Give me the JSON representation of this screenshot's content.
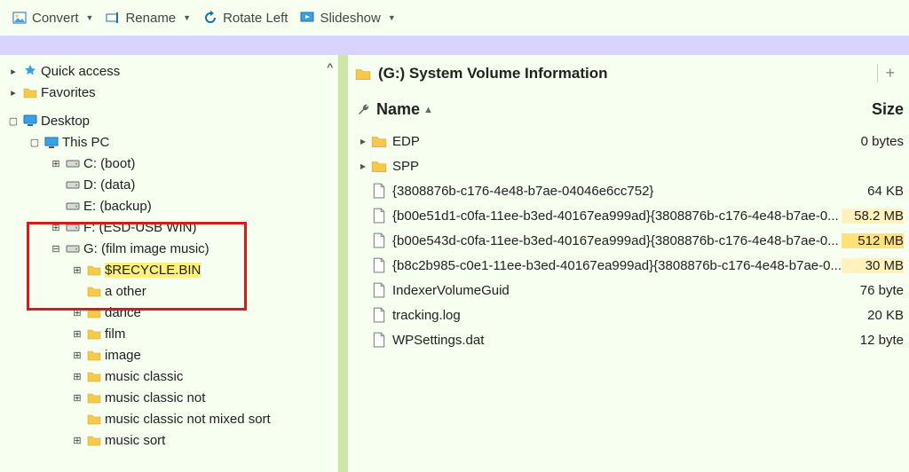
{
  "toolbar": {
    "convert": "Convert",
    "rename": "Rename",
    "rotate_left": "Rotate Left",
    "slideshow": "Slideshow"
  },
  "tree": {
    "quick_access": "Quick access",
    "favorites": "Favorites",
    "desktop": "Desktop",
    "this_pc": "This PC",
    "drive_c": "C: (boot)",
    "drive_d": "D: (data)",
    "drive_e": "E: (backup)",
    "drive_f": "F: (ESD-USB WIN)",
    "drive_g": "G: (film image music)",
    "g_children": [
      "$RECYCLE.BIN",
      "a other",
      "dance",
      "film",
      "image",
      "music classic",
      "music classic not",
      "music classic not mixed sort",
      "music sort"
    ]
  },
  "breadcrumb": {
    "title": "(G:) System Volume Information"
  },
  "columns": {
    "name": "Name",
    "size": "Size"
  },
  "rows": [
    {
      "type": "folder",
      "expandable": true,
      "name": "EDP",
      "size": "0 bytes",
      "hl": ""
    },
    {
      "type": "folder",
      "expandable": true,
      "name": "SPP",
      "size": "",
      "hl": ""
    },
    {
      "type": "file",
      "expandable": false,
      "name": "{3808876b-c176-4e48-b7ae-04046e6cc752}",
      "size": "64 KB",
      "hl": ""
    },
    {
      "type": "file",
      "expandable": false,
      "name": "{b00e51d1-c0fa-11ee-b3ed-40167ea999ad}{3808876b-c176-4e48-b7ae-0...",
      "size": "58.2 MB",
      "hl": "hl-size"
    },
    {
      "type": "file",
      "expandable": false,
      "name": "{b00e543d-c0fa-11ee-b3ed-40167ea999ad}{3808876b-c176-4e48-b7ae-0...",
      "size": "512 MB",
      "hl": "hl-size-strong"
    },
    {
      "type": "file",
      "expandable": false,
      "name": "{b8c2b985-c0e1-11ee-b3ed-40167ea999ad}{3808876b-c176-4e48-b7ae-0...",
      "size": "30 MB",
      "hl": "hl-size"
    },
    {
      "type": "file",
      "expandable": false,
      "name": "IndexerVolumeGuid",
      "size": "76 byte",
      "hl": ""
    },
    {
      "type": "file",
      "expandable": false,
      "name": "tracking.log",
      "size": "20 KB",
      "hl": ""
    },
    {
      "type": "file",
      "expandable": false,
      "name": "WPSettings.dat",
      "size": "12 byte",
      "hl": ""
    }
  ]
}
